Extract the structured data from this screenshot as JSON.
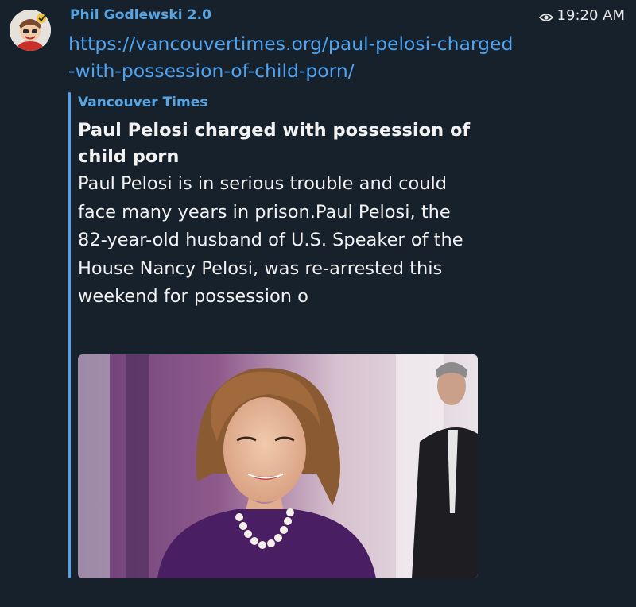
{
  "message": {
    "author": "Phil Godlewski 2.0",
    "time": "19:20 AM",
    "link": "https://vancouvertimes.org/paul-pelosi-charged-with-possession-of-child-porn/"
  },
  "preview": {
    "site_name": "Vancouver Times",
    "title": "Paul Pelosi charged with possession of child porn",
    "description": "Paul Pelosi is in serious trouble and could face many years in prison.Paul Pelosi, the 82-year-old husband of U.S. Speaker of the House Nancy Pelosi, was re-arrested this weekend for possession o"
  },
  "icons": {
    "views": "eye-icon",
    "avatar": "avatar-image"
  },
  "colors": {
    "background": "#17212b",
    "accent": "#4fa3f1",
    "author": "#56a6e6",
    "text": "#f2f2f2"
  }
}
